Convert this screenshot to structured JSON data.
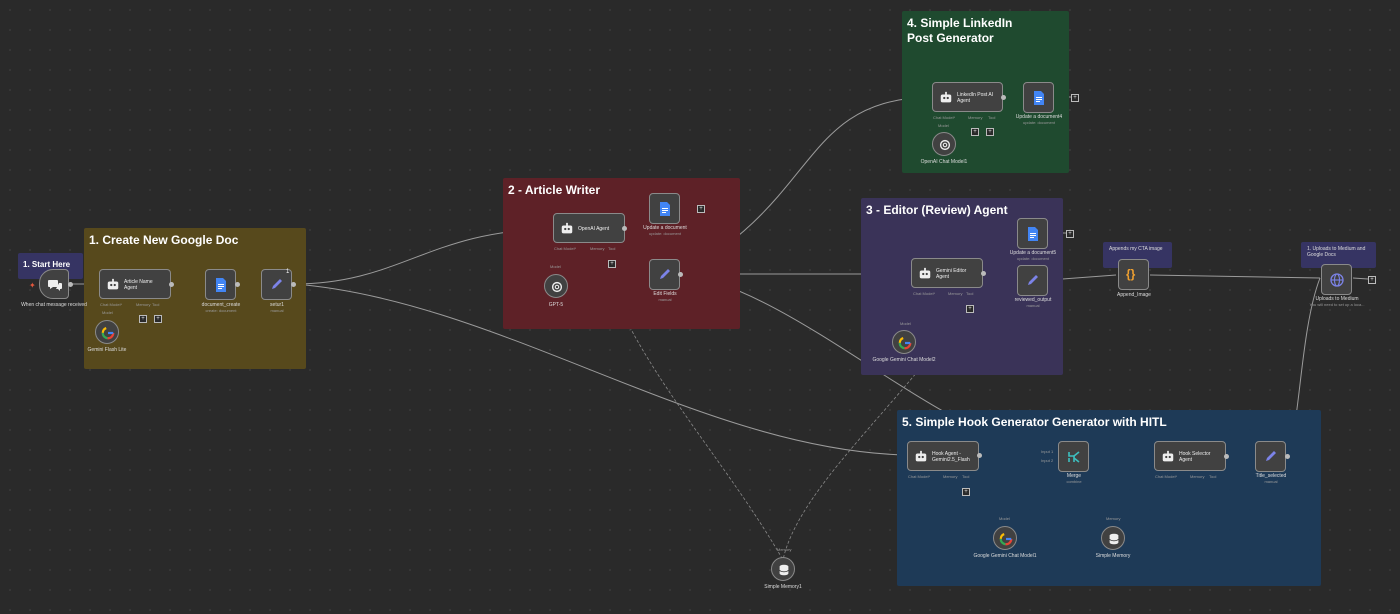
{
  "sticky_notes": {
    "start": "1. Start Here",
    "create_doc": "1. Create New Google Doc",
    "article_writer": "2 - Article Writer",
    "editor": "3 - Editor (Review) Agent",
    "linkedin": "4. Simple LinkedIn Post Generator",
    "hook": "5. Simple Hook Generator Generator with HITL",
    "cta": "Appends my CTA image",
    "upload": "1. Uploads to Medium and Google Docs"
  },
  "nodes": {
    "trigger": {
      "label": "When chat message received"
    },
    "article_name_agent": {
      "label": "Article Name Agent"
    },
    "gemini_flash_lite": {
      "label": "Gemini Flash Lite"
    },
    "document_create": {
      "label": "document_create",
      "sub": "create: document"
    },
    "setur1": {
      "label": "setur1",
      "sub": "manual",
      "badge": "1"
    },
    "openai_agent": {
      "label": "OpenAI Agent"
    },
    "gpt5": {
      "label": "GPT-5"
    },
    "update_document": {
      "label": "Update a document",
      "sub": "update: document"
    },
    "edit_fields": {
      "label": "Edit Fields",
      "sub": "manual"
    },
    "linkedin_agent": {
      "label": "LinkedIn Post AI Agent"
    },
    "update_document4": {
      "label": "Update a document4",
      "sub": "update: document"
    },
    "openai_chat_model1": {
      "label": "OpenAI Chat Model1"
    },
    "gemini_editor": {
      "label": "Gemini Editor Agent"
    },
    "update_document5": {
      "label": "Update a document5",
      "sub": "update: document"
    },
    "reviewed_output": {
      "label": "reviewed_output",
      "sub": "manual"
    },
    "google_gemini_chat_model2": {
      "label": "Google Gemini Chat Model2"
    },
    "append_image": {
      "label": "Append_Image"
    },
    "uploads_to_medium": {
      "label": "Uploads to Medium",
      "sub": "You will need to set up a loca..."
    },
    "hook_agent": {
      "label": "Hook Agent - Gemini2.5_Flash"
    },
    "merge": {
      "label": "Merge",
      "sub": "combine"
    },
    "hook_selector": {
      "label": "Hook Selector Agent"
    },
    "title_selected": {
      "label": "Title_selected",
      "sub": "manual"
    },
    "google_gemini_chat_model1": {
      "label": "Google Gemini Chat Model1"
    },
    "simple_memory": {
      "label": "Simple Memory"
    },
    "simple_memory1": {
      "label": "Simple Memory1"
    }
  },
  "sub_ports": {
    "chat_model": "Chat Model*",
    "memory": "Memory",
    "tool": "Tool",
    "model": "Model",
    "input1": "Input 1",
    "input2": "Input 2"
  },
  "colors": {
    "canvas": "#2a2a2a",
    "yellow_note": "#57491c",
    "red_note": "#5e2127",
    "purple_note": "#3a3358",
    "green_note": "#1f4a2f",
    "blue_note": "#1e3a57",
    "indigo_note": "#363463"
  }
}
